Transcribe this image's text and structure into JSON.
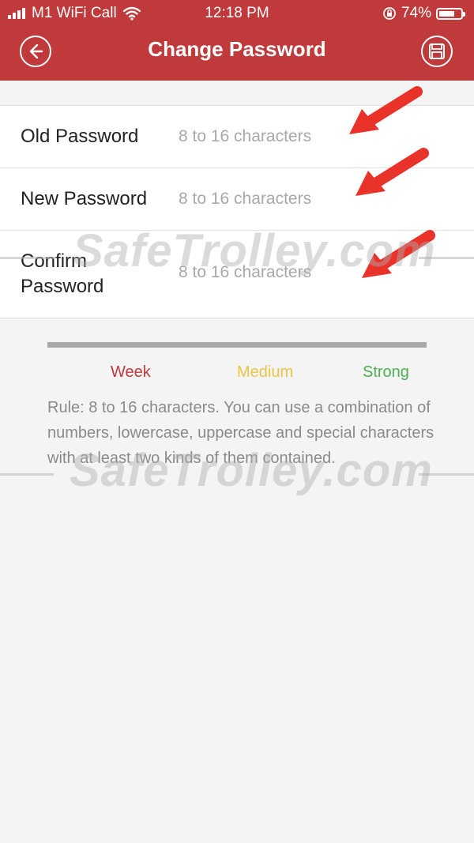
{
  "status_bar": {
    "carrier": "M1 WiFi Call",
    "time": "12:18 PM",
    "battery": "74%",
    "battery_level": 0.74
  },
  "header": {
    "title": "Change Password",
    "back_icon": "back-arrow-icon",
    "save_icon": "save-icon"
  },
  "form": {
    "fields": [
      {
        "label": "Old Password",
        "value": "",
        "placeholder": "8 to 16 characters"
      },
      {
        "label": "New Password",
        "value": "",
        "placeholder": "8 to 16 characters"
      },
      {
        "label": "Confirm\nPassword",
        "value": "",
        "placeholder": "8 to 16 characters"
      }
    ]
  },
  "strength": {
    "levels": [
      {
        "label": "Week",
        "color": "#c0393b"
      },
      {
        "label": "Medium",
        "color": "#e8c547"
      },
      {
        "label": "Strong",
        "color": "#4caf50"
      }
    ]
  },
  "rule_text": "Rule: 8 to 16 characters. You can use a combination of numbers, lowercase, uppercase and special characters with at least two kinds of them contained.",
  "watermark": "SafeTrolley.com",
  "colors": {
    "brand": "#c0393b",
    "annotation_arrow": "#e8322a"
  }
}
